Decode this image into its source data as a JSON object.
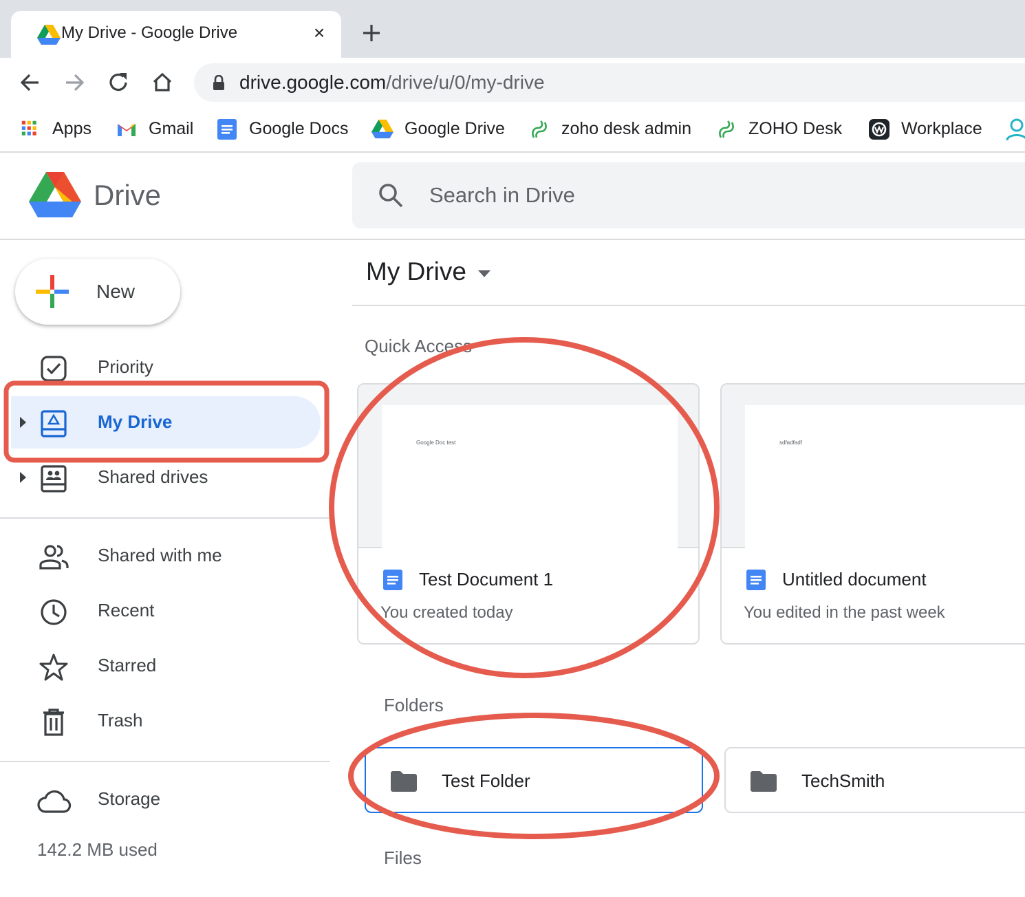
{
  "browser": {
    "tab_title": "My Drive - Google Drive",
    "close_glyph": "×",
    "url_host": "drive.google.com",
    "url_path": "/drive/u/0/my-drive"
  },
  "bookmarks": [
    {
      "label": "Apps",
      "icon": "apps-grid-icon"
    },
    {
      "label": "Gmail",
      "icon": "gmail-icon"
    },
    {
      "label": "Google Docs",
      "icon": "google-docs-icon"
    },
    {
      "label": "Google Drive",
      "icon": "google-drive-icon"
    },
    {
      "label": "zoho desk admin",
      "icon": "zoho-desk-icon"
    },
    {
      "label": "ZOHO Desk",
      "icon": "zoho-desk-icon"
    },
    {
      "label": "Workplace",
      "icon": "workplace-icon"
    }
  ],
  "drive": {
    "title": "Drive",
    "search_placeholder": "Search in Drive",
    "new_label": "New"
  },
  "sidebar": {
    "items": [
      {
        "label": "Priority",
        "icon": "priority-check-icon"
      },
      {
        "label": "My Drive",
        "icon": "my-drive-icon",
        "active": true
      },
      {
        "label": "Shared drives",
        "icon": "shared-drives-icon"
      },
      {
        "label": "Shared with me",
        "icon": "people-icon"
      },
      {
        "label": "Recent",
        "icon": "clock-icon"
      },
      {
        "label": "Starred",
        "icon": "star-icon"
      },
      {
        "label": "Trash",
        "icon": "trash-icon"
      },
      {
        "label": "Storage",
        "icon": "cloud-icon"
      }
    ],
    "storage_used": "142.2 MB used"
  },
  "main": {
    "title": "My Drive",
    "quick_access_label": "Quick Access",
    "quick_access": [
      {
        "name": "Test Document 1",
        "reason": "You created today",
        "preview_text": "Google Doc test"
      },
      {
        "name": "Untitled document",
        "reason": "You edited in the past week",
        "preview_text": "sdfadfadf"
      }
    ],
    "folders_label": "Folders",
    "folders": [
      {
        "name": "Test Folder",
        "selected": true
      },
      {
        "name": "TechSmith"
      }
    ],
    "files_label": "Files"
  },
  "colors": {
    "accent": "#1a73e8",
    "active_bg": "#e8f0fe",
    "annotation": "#e55c4e"
  }
}
